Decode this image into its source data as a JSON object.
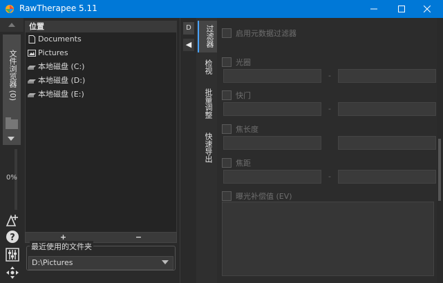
{
  "window": {
    "title": "RawTherapee 5.11",
    "minimize": "—",
    "maximize": "☐",
    "close": "✕"
  },
  "left_strip": {
    "file_browser_tab": "文件浏览器 (0)",
    "zoom_label": "0%",
    "icons": [
      "triangle-up-icon",
      "folder-icon",
      "triangle-down-icon",
      "send-to-editor-icon",
      "help-icon",
      "preferences-icon",
      "fullscreen-icon"
    ]
  },
  "places": {
    "header": "位置",
    "items": [
      {
        "label": "Documents",
        "icon": "document-icon"
      },
      {
        "label": "Pictures",
        "icon": "picture-icon"
      },
      {
        "label": "本地磁盘 (C:)",
        "icon": "drive-icon"
      },
      {
        "label": "本地磁盘 (D:)",
        "icon": "drive-icon"
      },
      {
        "label": "本地磁盘 (E:)",
        "icon": "drive-icon"
      }
    ],
    "add": "+",
    "remove": "−"
  },
  "recent": {
    "legend": "最近使用的文件夹",
    "value": "D:\\Pictures"
  },
  "mid": {
    "tab_label": "D",
    "back_arrow": "◀"
  },
  "vertical_tabs": [
    "过滤器",
    "检视",
    "批量调整",
    "快速导出"
  ],
  "filter": {
    "enable_label": "启用元数据过滤器",
    "fields": [
      "光圈",
      "快门",
      "焦长度",
      "焦距",
      "曝光补偿值 (EV)"
    ]
  },
  "colors": {
    "titlebar": "#0078d7",
    "active_tab_accent": "#4aa3ff"
  }
}
